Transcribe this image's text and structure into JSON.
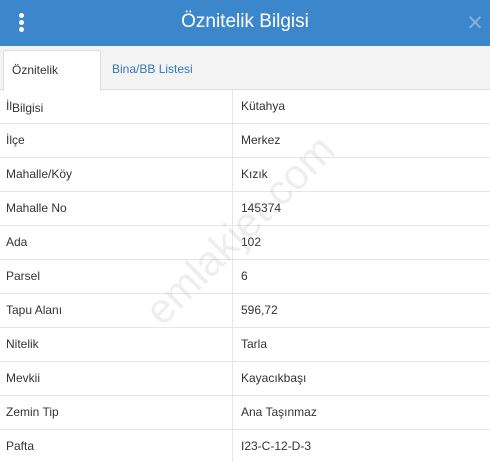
{
  "header": {
    "title": "Öznitelik Bilgisi",
    "menu_icon": "vertical-dots-icon",
    "close_icon": "close-icon",
    "close_symbol": "×"
  },
  "colors": {
    "header_bg": "#3c87cc",
    "link": "#337ab7",
    "tabbar_bg": "#f3f3f3"
  },
  "tabs": [
    {
      "label": "Öznitelik Bilgisi",
      "active": true
    },
    {
      "label": "Bina/BB Listesi",
      "active": false
    }
  ],
  "rows": [
    {
      "label": "İl",
      "value": "Kütahya"
    },
    {
      "label": "İlçe",
      "value": "Merkez"
    },
    {
      "label": "Mahalle/Köy",
      "value": "Kızık"
    },
    {
      "label": "Mahalle No",
      "value": "145374"
    },
    {
      "label": "Ada",
      "value": "102"
    },
    {
      "label": "Parsel",
      "value": "6"
    },
    {
      "label": "Tapu Alanı",
      "value": "596,72"
    },
    {
      "label": "Nitelik",
      "value": "Tarla"
    },
    {
      "label": "Mevkii",
      "value": "Kayacıkbaşı"
    },
    {
      "label": "Zemin Tip",
      "value": "Ana Taşınmaz"
    },
    {
      "label": "Pafta",
      "value": "I23-C-12-D-3"
    }
  ],
  "watermark": "emlakjet.com"
}
